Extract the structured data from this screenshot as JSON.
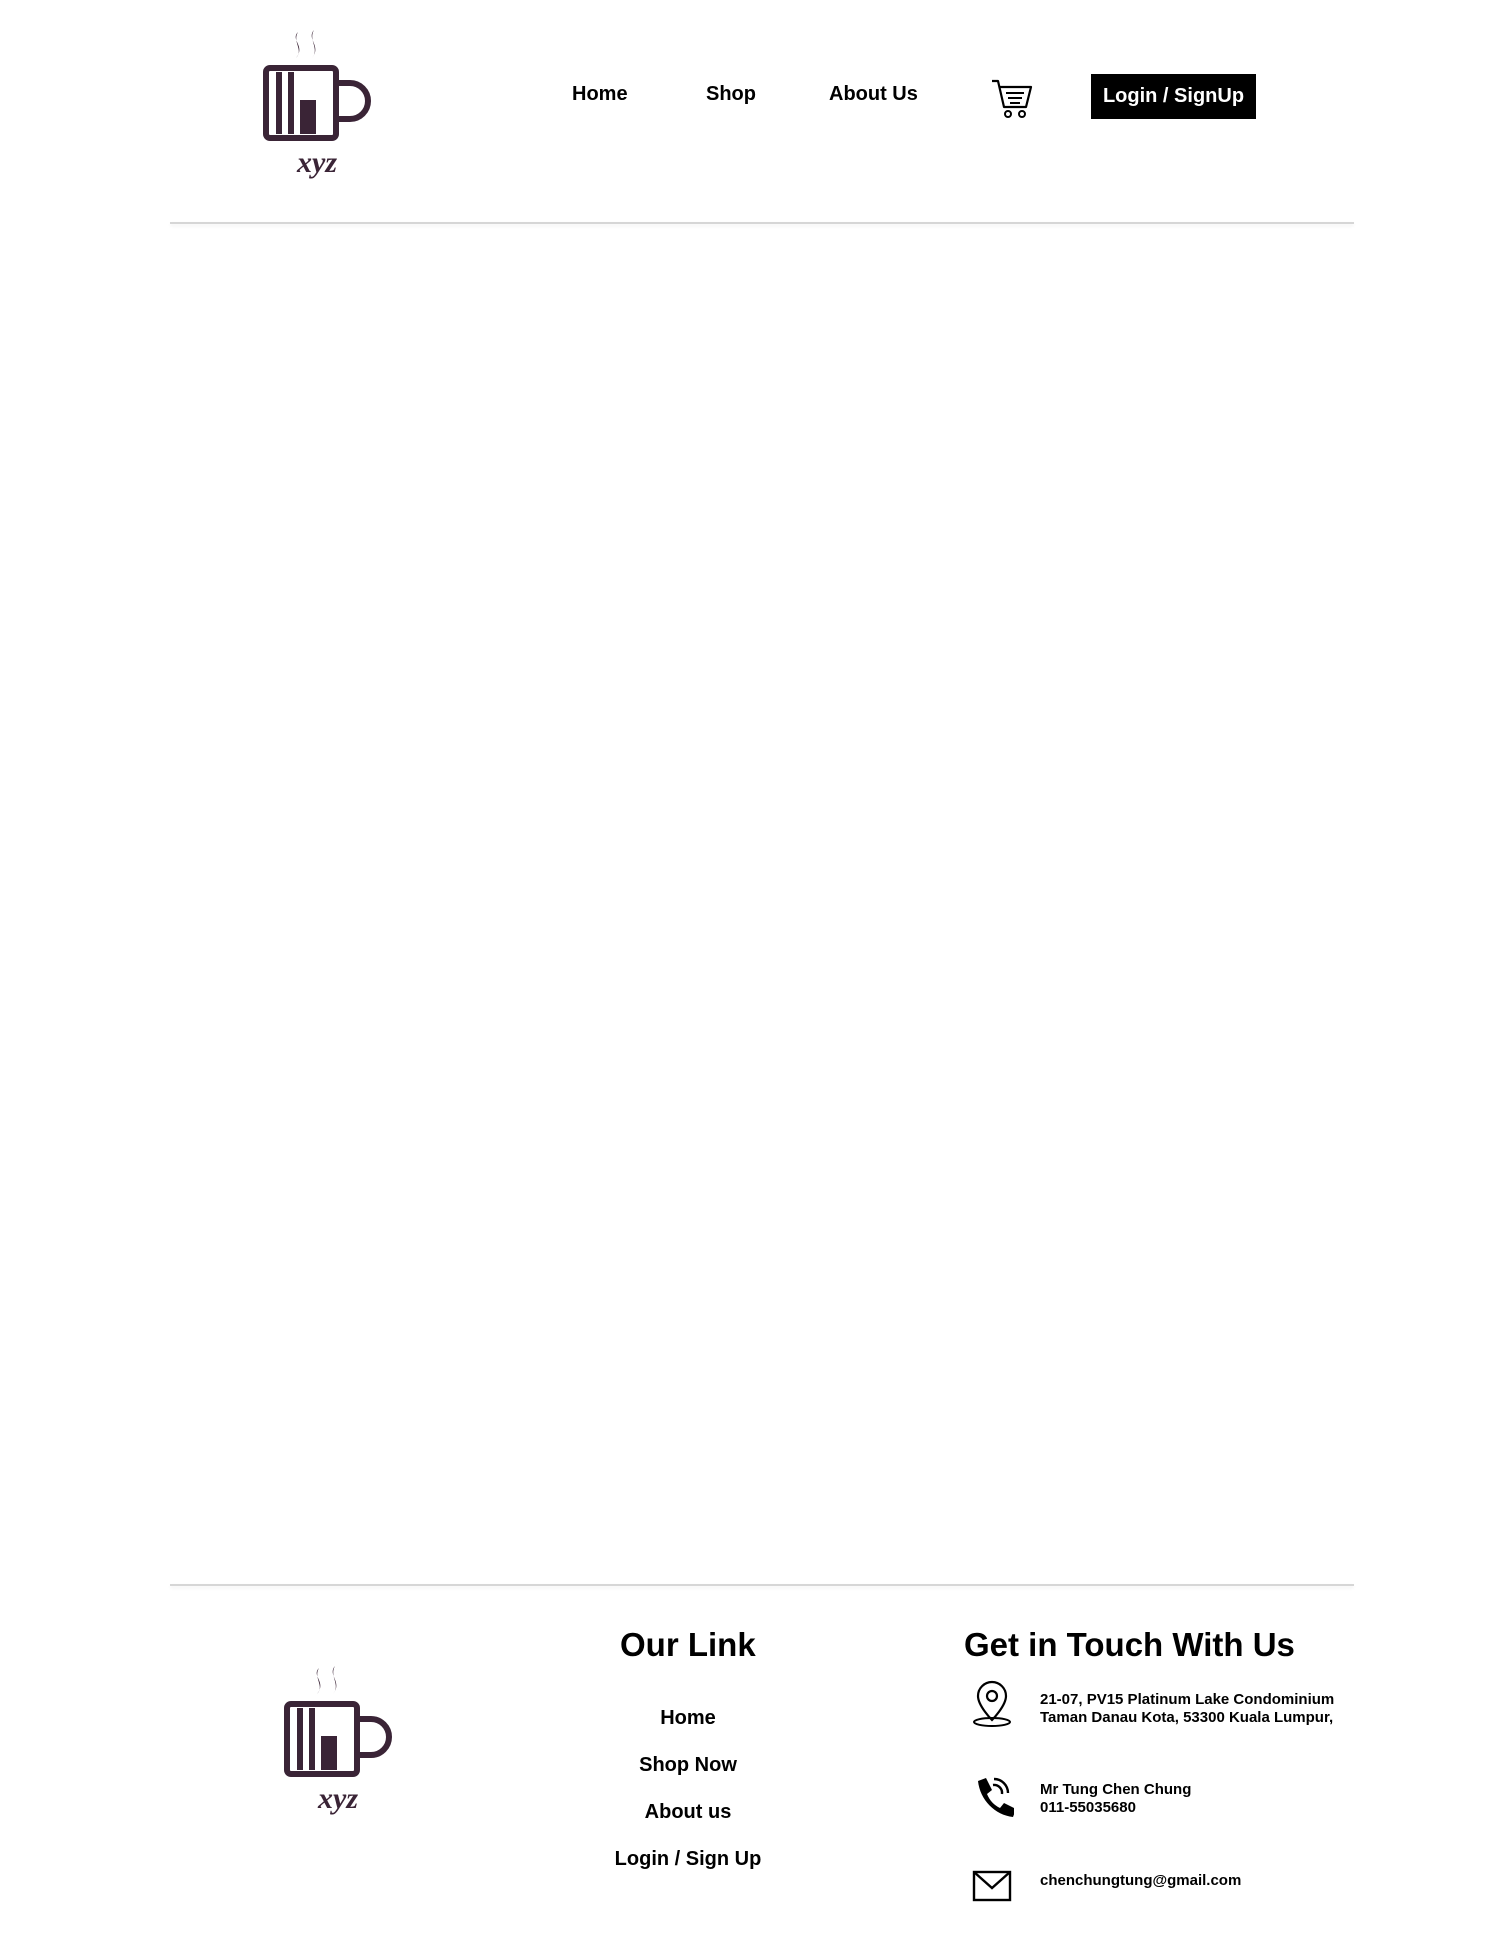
{
  "brand": {
    "logo_text": "xyz",
    "logo_color": "#3a2436"
  },
  "nav": {
    "home": "Home",
    "shop": "Shop",
    "about": "About Us",
    "cart_icon": "shopping-cart-icon",
    "login": "Login / SignUp"
  },
  "footer": {
    "links_heading": "Our Link",
    "links": [
      "Home",
      "Shop Now",
      "About us",
      "Login / Sign Up"
    ],
    "contact_heading": "Get in Touch With Us",
    "address_line1": "21-07, PV15 Platinum Lake  Condominium",
    "address_line2": "Taman Danau Kota, 53300 Kuala Lumpur,",
    "contact_name": "Mr Tung Chen Chung",
    "phone": "011-55035680",
    "email": "chenchungtung@gmail.com",
    "icons": [
      "location-pin-icon",
      "phone-icon",
      "mail-icon"
    ]
  }
}
